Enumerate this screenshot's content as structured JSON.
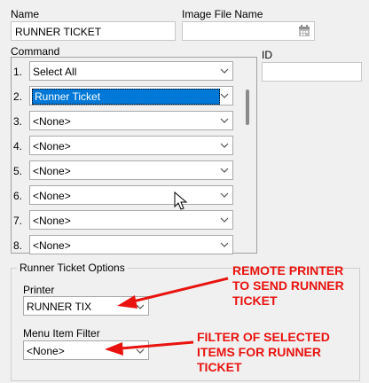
{
  "fields": {
    "name_label": "Name",
    "name_value": "RUNNER TICKET",
    "image_label": "Image File Name",
    "image_value": "",
    "id_label": "ID",
    "id_value": ""
  },
  "command": {
    "label": "Command",
    "rows": [
      {
        "num": "1.",
        "value": "Select All",
        "selected": false
      },
      {
        "num": "2.",
        "value": "Runner Ticket",
        "selected": true
      },
      {
        "num": "3.",
        "value": "<None>",
        "selected": false
      },
      {
        "num": "4.",
        "value": "<None>",
        "selected": false
      },
      {
        "num": "5.",
        "value": "<None>",
        "selected": false
      },
      {
        "num": "6.",
        "value": "<None>",
        "selected": false
      },
      {
        "num": "7.",
        "value": "<None>",
        "selected": false
      },
      {
        "num": "8.",
        "value": "<None>",
        "selected": false
      }
    ]
  },
  "options": {
    "group_title": "Runner Ticket Options",
    "printer_label": "Printer",
    "printer_value": "RUNNER TIX",
    "filter_label": "Menu Item Filter",
    "filter_value": "<None>"
  },
  "annotations": {
    "printer_note": "REMOTE PRINTER\nTO SEND RUNNER\nTICKET",
    "filter_note": "FILTER OF SELECTED\nITEMS FOR RUNNER\nTICKET",
    "color": "#e8130f"
  }
}
